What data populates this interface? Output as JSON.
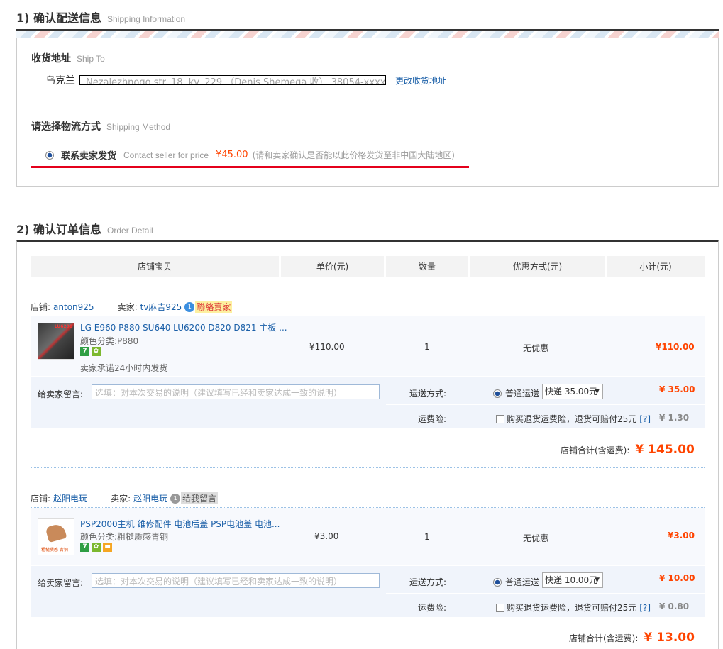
{
  "section1": {
    "title_zh": "1) 确认配送信息",
    "title_en": "Shipping Information",
    "ship_to": {
      "title_zh": "收货地址",
      "title_en": "Ship To",
      "country": "乌克兰",
      "address_obscured": "Nezalezhnogo str. 18, kv. 229 （Denis Shemega 收） 38054-xxxx",
      "change_link": "更改收货地址"
    },
    "method": {
      "title_zh": "请选择物流方式",
      "title_en": "Shipping Method",
      "option_zh": "联系卖家发货",
      "option_en": "Contact seller for price",
      "price": "¥45.00",
      "note": "(请和卖家确认是否能以此价格发货至非中国大陆地区)"
    }
  },
  "section2": {
    "title_zh": "2) 确认订单信息",
    "title_en": "Order Detail",
    "headers": [
      "店铺宝贝",
      "单价(元)",
      "数量",
      "优惠方式(元)",
      "小计(元)"
    ]
  },
  "labels": {
    "shop": "店铺:",
    "seller": "卖家:",
    "message": "给卖家留言:",
    "message_placeholder": "选填：对本次交易的说明（建议填写已经和卖家达成一致的说明）",
    "shipping": "运送方式:",
    "normal_ship": "普通运送",
    "insurance": "运费险:",
    "insurance_text": "购买退货运费险，退货可赔付25元",
    "help": "[?]",
    "shop_total": "店铺合计(含运费):"
  },
  "orders": [
    {
      "shop": "anton925",
      "seller": "tv麻吉925",
      "wang_label": "聯絡賣家",
      "thumb_text": "LU6200",
      "title": "LG E960 P880 SU640 LU6200 D820 D821 主板 ...",
      "attr": "颜色分类:P880",
      "promise": "卖家承诺24小时内发货",
      "price": "¥110.00",
      "qty": "1",
      "discount": "无优惠",
      "subtotal": "¥110.00",
      "ship_select": "快递 35.00元",
      "ship_fee": "¥ 35.00",
      "ins_fee": "¥ 1.30",
      "total": "¥ 145.00"
    },
    {
      "shop": "赵阳电玩",
      "seller": "赵阳电玩",
      "wang_label": "给我留言",
      "thumb_text": "粗糙质感 青铜",
      "title": "PSP2000主机 维修配件 电池后盖 PSP电池盖 电池...",
      "attr": "颜色分类:粗糙质感青铜",
      "price": "¥3.00",
      "qty": "1",
      "discount": "无优惠",
      "subtotal": "¥3.00",
      "ship_select": "快递 10.00元",
      "ship_fee": "¥ 10.00",
      "ins_fee": "¥ 0.80",
      "total": "¥ 13.00"
    }
  ],
  "colors": {
    "accent_orange": "#ff4400",
    "link_blue": "#1a5fa8",
    "highlight_red": "#e4001b"
  }
}
